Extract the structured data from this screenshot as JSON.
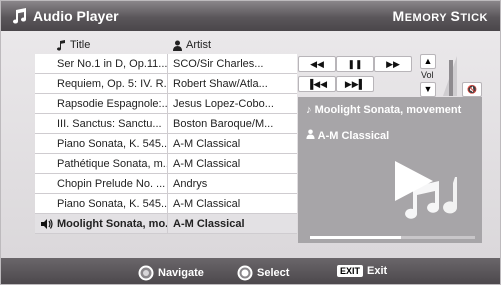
{
  "header": {
    "title": "Audio Player",
    "brand_first": "M",
    "brand_rest": "EMORY ",
    "brand_first2": "S",
    "brand_rest2": "TICK"
  },
  "columns": {
    "title": "Title",
    "artist": "Artist"
  },
  "tracks": [
    {
      "title": "Ser No.1 in D, Op.11...",
      "artist": "SCO/Sir Charles..."
    },
    {
      "title": "Requiem, Op. 5: IV. R...",
      "artist": "Robert Shaw/Atla..."
    },
    {
      "title": "Rapsodie Espagnole:...",
      "artist": "Jesus Lopez-Cobo..."
    },
    {
      "title": "III. Sanctus: Sanctu...",
      "artist": "Boston Baroque/M..."
    },
    {
      "title": "Piano Sonata, K. 545...",
      "artist": "A-M Classical"
    },
    {
      "title": "Pathétique Sonata, m...",
      "artist": "A-M Classical"
    },
    {
      "title": "Chopin Prelude No. ...",
      "artist": "Andrys"
    },
    {
      "title": "Piano Sonata, K. 545...",
      "artist": "A-M Classical"
    },
    {
      "title": "Moolight Sonata, mo...",
      "artist": "A-M Classical"
    }
  ],
  "playing_index": 8,
  "controls": {
    "rewind": "◀◀",
    "pause": "❚❚",
    "ffwd": "▶▶",
    "prev": "▐◀◀",
    "next": "▶▶▌",
    "vol_up": "▲",
    "vol_down": "▼",
    "vol_label": "Vol",
    "mute": "🔇"
  },
  "now_playing": {
    "title": "Moolight Sonata, movement",
    "artist": "A-M Classical",
    "progress": 0.55
  },
  "footer": {
    "navigate": "Navigate",
    "select": "Select",
    "exit_key": "EXIT",
    "exit": "Exit"
  },
  "colors": {
    "header_dark": "#4a464a",
    "panel_grey": "#a7a5a8",
    "row_highlight": "#e3e1e4"
  },
  "icons": {
    "header": "music-note-icon",
    "title_col": "note-icon",
    "artist_col": "person-icon",
    "playing": "speaker-icon",
    "navigate": "dpad-icon",
    "select": "ok-button-icon"
  }
}
